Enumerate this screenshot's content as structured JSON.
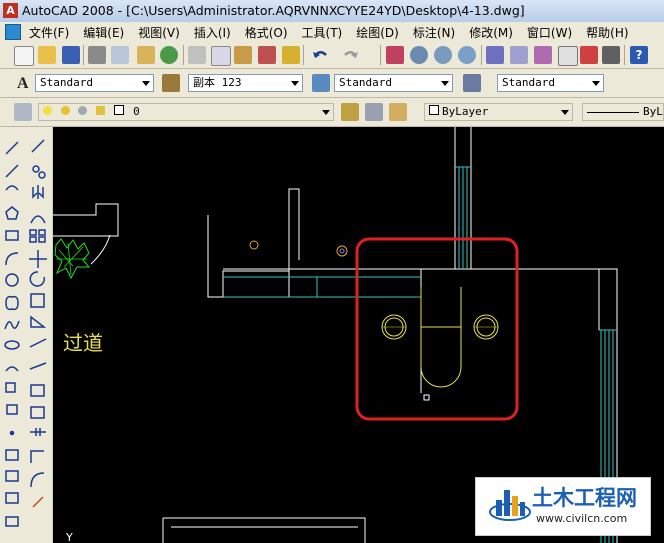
{
  "window": {
    "title": "AutoCAD 2008 - [C:\\Users\\Administrator.AQRVNNXCYYE24YD\\Desktop\\4-13.dwg]"
  },
  "menu": [
    "文件(F)",
    "编辑(E)",
    "视图(V)",
    "插入(I)",
    "格式(O)",
    "工具(T)",
    "绘图(D)",
    "标注(N)",
    "修改(M)",
    "窗口(W)",
    "帮助(H)"
  ],
  "styles": {
    "text_style": "Standard",
    "dim_style": "副本 123",
    "table_style": "Standard",
    "multileader_style": "Standard"
  },
  "layers": {
    "current_layer": "0",
    "color": "ByLayer",
    "linetype": "ByL"
  },
  "drawing": {
    "room_label": "过道",
    "ucs_axis_label": "Y"
  },
  "watermark": {
    "title": "土木工程网",
    "url": "www.civilcn.com"
  },
  "colors": {
    "canvas_bg": "#000000",
    "wall": "#ffffff",
    "cyan": "#35c6c6",
    "yellow": "#e8e04a",
    "highlight": "#e02020",
    "green": "#22dd22",
    "brand_blue": "#1b5fb5"
  },
  "icons": [
    "new-icon",
    "open-icon",
    "save-icon",
    "print-icon",
    "preview-icon",
    "publish-icon",
    "cut-icon",
    "copy-icon",
    "paste-icon",
    "match-props-icon",
    "undo-icon",
    "redo-icon",
    "pan-icon",
    "zoom-realtime-icon",
    "zoom-window-icon",
    "zoom-previous-icon",
    "properties-icon",
    "design-center-icon",
    "tool-palettes-icon",
    "sheet-set-icon",
    "markup-icon",
    "quickcalc-icon",
    "help-icon"
  ]
}
